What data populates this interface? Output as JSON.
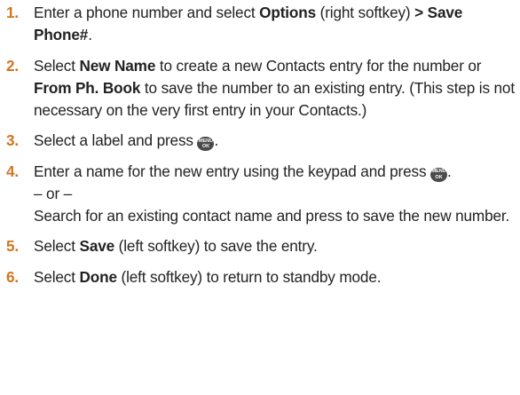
{
  "icons": {
    "menu_ok_key": "menu-ok-key-icon"
  },
  "colors": {
    "step_number": "#d4741e",
    "text": "#222222",
    "key_icon": "#4a4a4a"
  },
  "steps": [
    {
      "num": "1.",
      "t1": "Enter a phone number and select ",
      "b1": "Options",
      "t2": " (right softkey) ",
      "b2": "> Save Phone#",
      "t3": "."
    },
    {
      "num": "2.",
      "t1": "Select ",
      "b1": "New Name",
      "t2": " to create a new Contacts entry for the number or ",
      "b2": "From Ph. Book",
      "t3": " to save the number to an existing entry. (This step is not necessary on the very first entry in your Contacts.)"
    },
    {
      "num": "3.",
      "t1": "Select a label and press ",
      "key_top": "MENU",
      "key_bottom": "OK",
      "t2": "."
    },
    {
      "num": "4.",
      "t1": "Enter a name for the new entry using the keypad and press ",
      "key_top": "MENU",
      "key_bottom": "OK",
      "t2": ".",
      "or": "– or –",
      "t3": "Search for an existing contact name and press to save the new number."
    },
    {
      "num": "5.",
      "t1": "Select ",
      "b1": "Save",
      "t2": " (left softkey) to save the entry."
    },
    {
      "num": "6.",
      "t1": "Select ",
      "b1": "Done",
      "t2": " (left softkey) to return to standby mode."
    }
  ]
}
